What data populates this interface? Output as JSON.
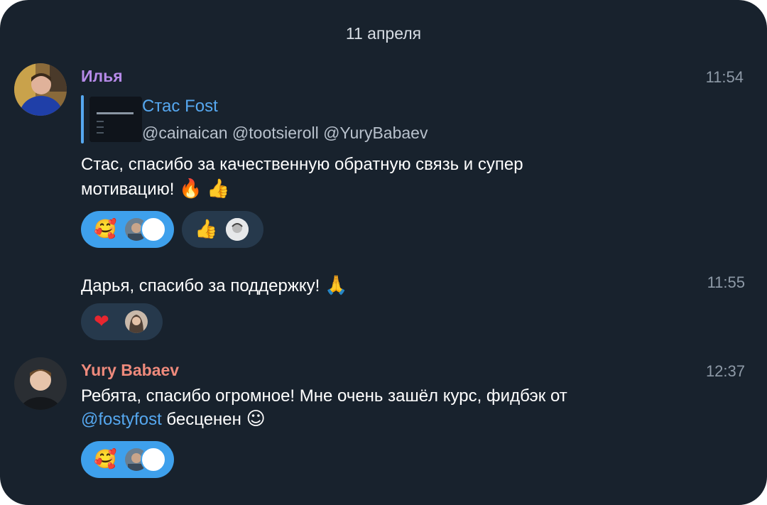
{
  "date_separator": "11 апреля",
  "messages": [
    {
      "author": "Илья",
      "time": "11:54",
      "reply": {
        "author": "Стас Fost",
        "text": "@cainaican @tootsieroll @YuryBabaev"
      },
      "text_line1": "Стас, спасибо за качественную обратную связь и супер",
      "text_line2": "мотивацию!",
      "emojis": [
        "fire",
        "thumbs-up"
      ],
      "reactions": [
        {
          "emoji": "smiling-face-with-hearts",
          "active": true
        },
        {
          "emoji": "thumbs-up",
          "active": false
        }
      ]
    },
    {
      "time": "11:55",
      "text": "Дарья, спасибо за поддержку!",
      "emoji": "folded-hands",
      "reactions": [
        {
          "emoji": "red-heart",
          "active": false
        }
      ]
    },
    {
      "author": "Yury Babaev",
      "time": "12:37",
      "text_line1": "Ребята, спасибо огромное! Мне очень зашёл курс, фидбэк от",
      "mention": "@fostyfost",
      "text_line2_rest": " бесценен",
      "emoji": "smiling-face",
      "reactions": [
        {
          "emoji": "smiling-face-with-hearts",
          "active": true
        }
      ]
    }
  ],
  "colors": {
    "background": "#18222d",
    "author_ilya": "#b68ae8",
    "author_yury": "#ee8a7c",
    "link": "#56a8f0",
    "reaction_active": "#3ea0ec",
    "reaction_inactive": "#26394c"
  }
}
